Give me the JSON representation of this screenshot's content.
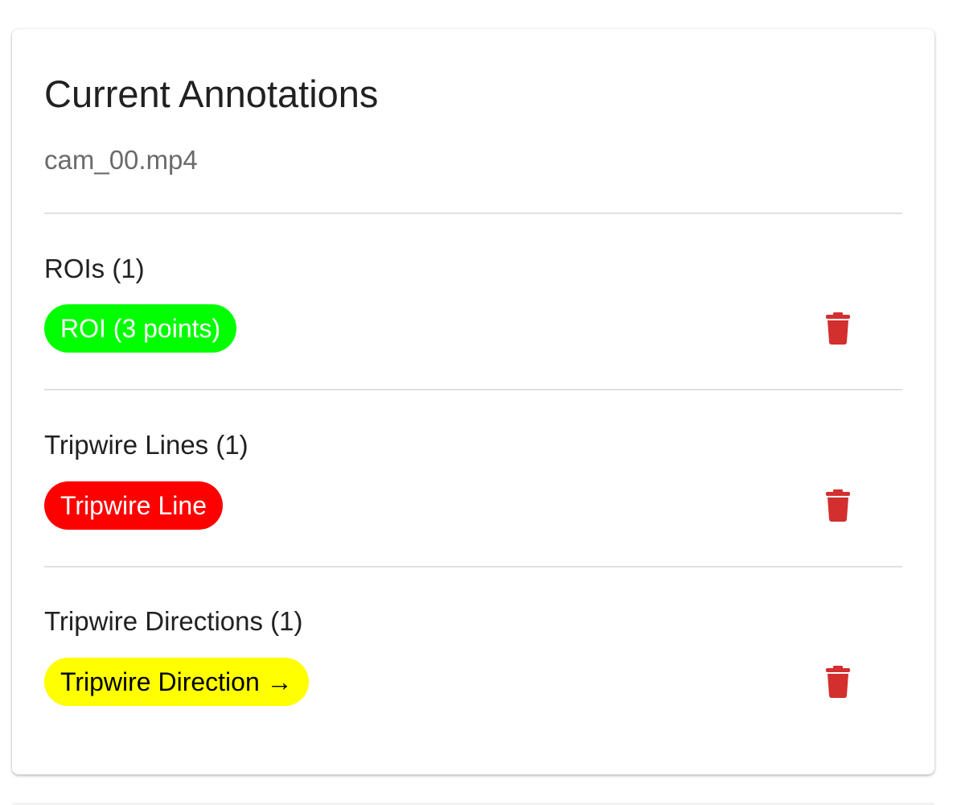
{
  "card": {
    "title": "Current Annotations",
    "filename": "cam_00.mp4"
  },
  "sections": [
    {
      "heading": "ROIs (1)",
      "chip_label": "ROI (3 points)",
      "chip_color": "#00ff00",
      "chip_text_color": "#ffffff",
      "delete_icon": "trash-icon"
    },
    {
      "heading": "Tripwire Lines (1)",
      "chip_label": "Tripwire Line",
      "chip_color": "#ff0000",
      "chip_text_color": "#ffffff",
      "delete_icon": "trash-icon"
    },
    {
      "heading": "Tripwire Directions (1)",
      "chip_label": "Tripwire Direction →",
      "chip_color": "#ffff00",
      "chip_text_color": "#000000",
      "delete_icon": "trash-icon"
    }
  ],
  "colors": {
    "delete_icon": "#d32f2f",
    "divider": "#e0e0e0"
  }
}
